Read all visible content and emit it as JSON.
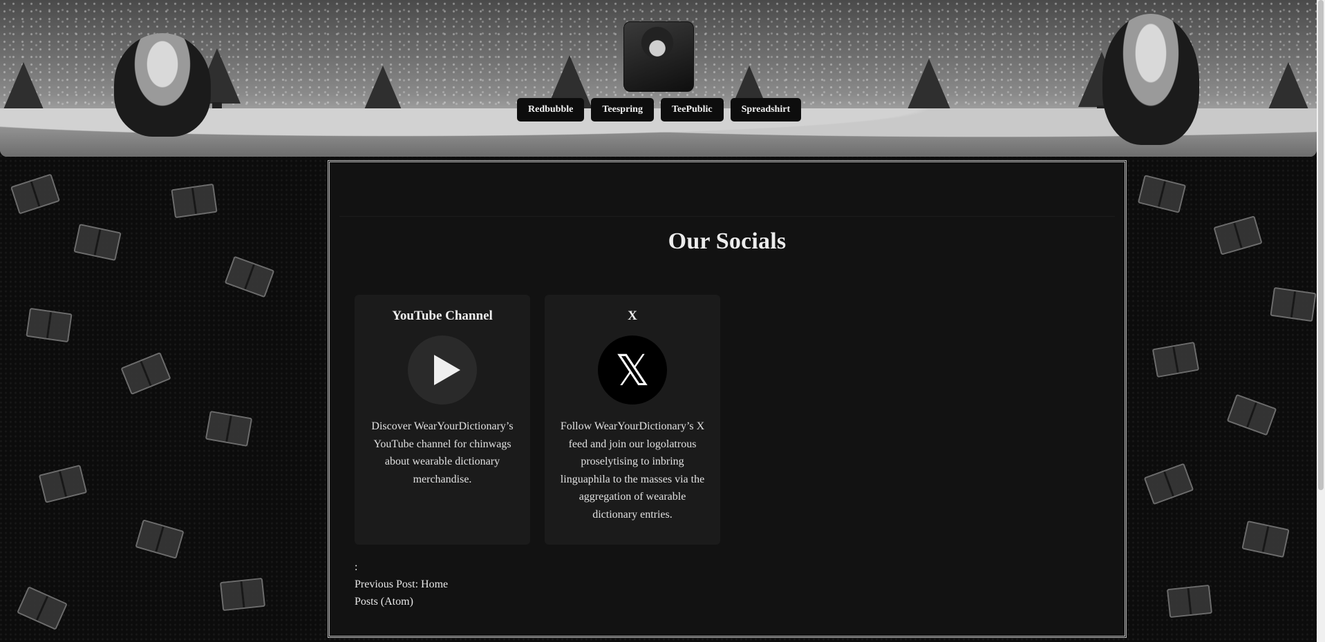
{
  "header": {
    "shop_links": [
      "Redbubble",
      "Teespring",
      "TeePublic",
      "Spreadshirt"
    ]
  },
  "main": {
    "title": "Our Socials",
    "cards": [
      {
        "title": "YouTube Channel",
        "icon": "play-icon",
        "description": "Discover WearYourDictionary’s YouTube channel for chinwags about wearable dictionary merchandise."
      },
      {
        "title": "X",
        "icon": "x-logo-icon",
        "icon_glyph": "𝕏",
        "description": "Follow WearYourDictionary’s X feed and join our logolatrous proselytising to inbring linguaphila to the masses via the aggregation of wearable dictionary entries."
      }
    ],
    "post_nav": {
      "separator": ":",
      "previous_post": "Previous Post: Home",
      "feed": "Posts (Atom)"
    }
  },
  "colors": {
    "panel_background": "#121212",
    "card_background": "#1b1b1b",
    "button_background": "#0d0d0d",
    "text": "#ececec"
  }
}
